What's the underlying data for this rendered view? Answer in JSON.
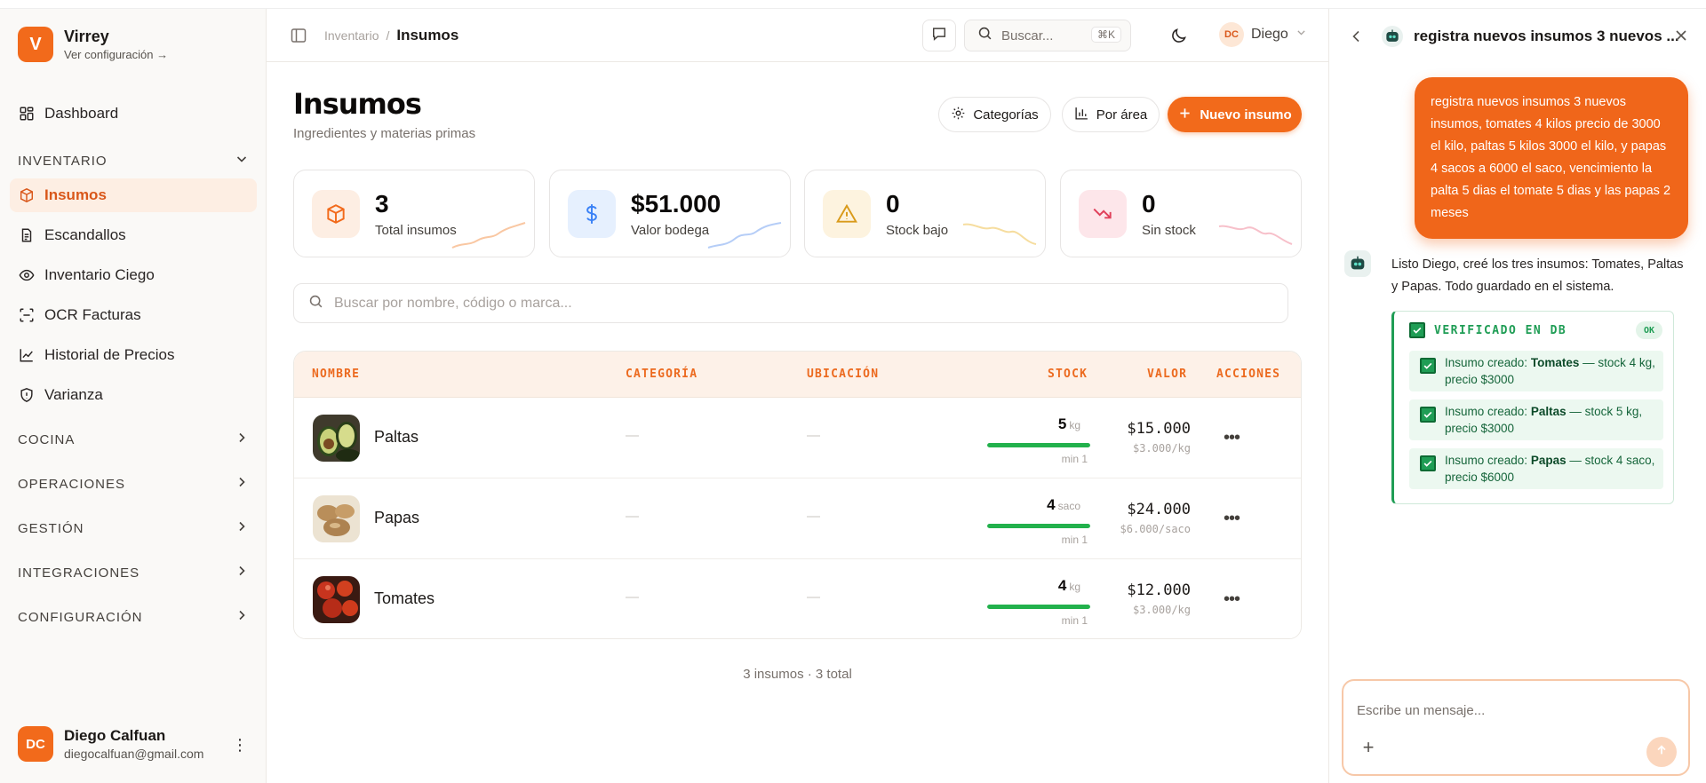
{
  "colors": {
    "accent": "#f26a1b",
    "accent_soft": "#fdeee3",
    "success": "#22b14c",
    "verify_green": "#1f9d55"
  },
  "brand": {
    "initial": "V",
    "name": "Virrey",
    "sub": "Ver configuración →"
  },
  "sidebar": {
    "dashboard": {
      "label": "Dashboard",
      "icon": "dashboard-icon"
    },
    "inventario_section": "INVENTARIO",
    "items": [
      {
        "label": "Insumos",
        "icon": "box-icon",
        "active": true
      },
      {
        "label": "Escandallos",
        "icon": "document-icon"
      },
      {
        "label": "Inventario Ciego",
        "icon": "eye-icon"
      },
      {
        "label": "OCR Facturas",
        "icon": "scan-icon"
      },
      {
        "label": "Historial de Precios",
        "icon": "line-chart-icon"
      },
      {
        "label": "Varianza",
        "icon": "shield-icon"
      }
    ],
    "sections": [
      "COCINA",
      "OPERACIONES",
      "GESTIÓN",
      "INTEGRACIONES",
      "CONFIGURACIÓN"
    ],
    "user": {
      "initials": "DC",
      "name": "Diego Calfuan",
      "email": "diegocalfuan@gmail.com"
    }
  },
  "header": {
    "breadcrumb_parent": "Inventario",
    "breadcrumb_sep": "/",
    "breadcrumb_current": "Insumos",
    "search_placeholder": "Buscar...",
    "shortcut": "⌘K",
    "user_initials": "DC",
    "user_name": "Diego"
  },
  "page": {
    "title": "Insumos",
    "subtitle": "Ingredientes y materias primas",
    "buttons": {
      "categorias": "Categorías",
      "por_area": "Por área",
      "nuevo": "Nuevo insumo"
    }
  },
  "stats": [
    {
      "value": "3",
      "label": "Total insumos",
      "icon": "box-icon",
      "color": "#f26a1b",
      "bg": "#fdeee3"
    },
    {
      "value": "$51.000",
      "label": "Valor bodega",
      "icon": "dollar-icon",
      "color": "#3b82f6",
      "bg": "#e6f0fe"
    },
    {
      "value": "0",
      "label": "Stock bajo",
      "icon": "warning-icon",
      "color": "#d99a1a",
      "bg": "#fdf3df"
    },
    {
      "value": "0",
      "label": "Sin stock",
      "icon": "trend-down-icon",
      "color": "#e0405a",
      "bg": "#fde6ea"
    }
  ],
  "search_main": {
    "placeholder": "Buscar por nombre, código o marca..."
  },
  "table": {
    "headers": {
      "nombre": "NOMBRE",
      "categoria": "CATEGORÍA",
      "ubicacion": "UBICACIÓN",
      "stock": "STOCK",
      "valor": "VALOR",
      "acciones": "ACCIONES"
    },
    "rows": [
      {
        "name": "Paltas",
        "categoria": "—",
        "ubicacion": "—",
        "stock": "5",
        "unit": "kg",
        "min": "min 1",
        "stock_level": 1.0,
        "value": "$15.000",
        "unit_price": "$3.000/kg",
        "thumb": "avocado"
      },
      {
        "name": "Papas",
        "categoria": "—",
        "ubicacion": "—",
        "stock": "4",
        "unit": "saco",
        "min": "min 1",
        "stock_level": 1.0,
        "value": "$24.000",
        "unit_price": "$6.000/saco",
        "thumb": "potato"
      },
      {
        "name": "Tomates",
        "categoria": "—",
        "ubicacion": "—",
        "stock": "4",
        "unit": "kg",
        "min": "min 1",
        "stock_level": 1.0,
        "value": "$12.000",
        "unit_price": "$3.000/kg",
        "thumb": "tomato"
      }
    ]
  },
  "footer": {
    "count": "3 insumos · 3 total"
  },
  "chat": {
    "title": "registra nuevos insumos 3 nuevos ...",
    "user_message": "registra nuevos insumos 3 nuevos insumos, tomates 4 kilos precio de 3000 el kilo, paltas 5 kilos 3000 el kilo, y papas 4 sacos a 6000 el saco, vencimiento la palta 5 dias el tomate 5 dias y las papas 2 meses",
    "bot_message": "Listo Diego, creé los tres insumos: Tomates, Paltas y Papas. Todo guardado en el sistema.",
    "verify": {
      "title": "VERIFICADO EN DB",
      "status": "OK",
      "items": [
        {
          "prefix": "Insumo creado:",
          "name": "Tomates",
          "detail": "— stock 4 kg, precio $3000"
        },
        {
          "prefix": "Insumo creado:",
          "name": "Paltas",
          "detail": "— stock 5 kg, precio $3000"
        },
        {
          "prefix": "Insumo creado:",
          "name": "Papas",
          "detail": "— stock 4 saco, precio $6000"
        }
      ]
    },
    "composer_placeholder": "Escribe un mensaje..."
  }
}
